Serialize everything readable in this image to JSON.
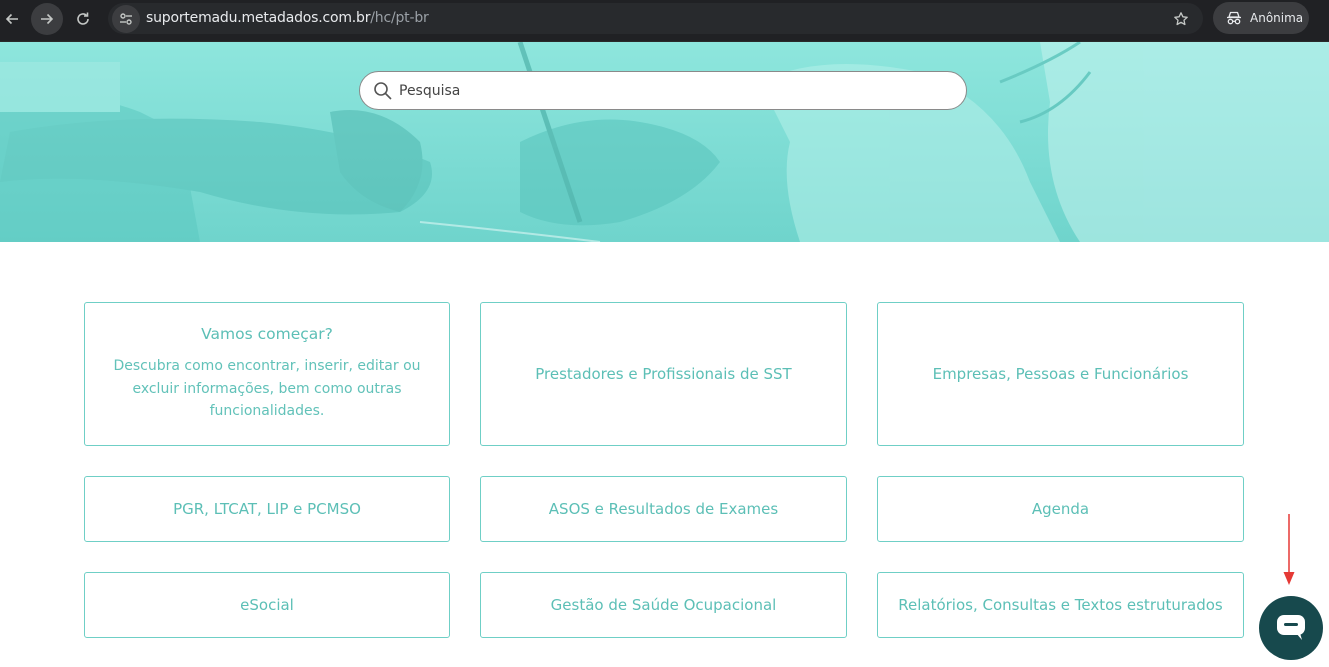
{
  "browser": {
    "url_host": "suportemadu.metadados.com.br",
    "url_path": "/hc/pt-br",
    "incognito_label": "Anônima"
  },
  "search": {
    "placeholder": "Pesquisa"
  },
  "categories": [
    {
      "title": "Vamos começar?",
      "description": "Descubra como encontrar, inserir, editar ou excluir informações, bem como outras funcionalidades."
    },
    {
      "title": "Prestadores e Profissionais de SST"
    },
    {
      "title": "Empresas, Pessoas e Funcionários"
    },
    {
      "title": "PGR, LTCAT, LIP e PCMSO"
    },
    {
      "title": "ASOS e Resultados de Exames"
    },
    {
      "title": "Agenda"
    },
    {
      "title": "eSocial"
    },
    {
      "title": "Gestão de Saúde Ocupacional"
    },
    {
      "title": "Relatórios, Consultas e Textos estruturados"
    }
  ],
  "colors": {
    "accent": "#5cbfb6",
    "hero": "#7ddcd4",
    "chat_button": "#17494d",
    "annotation_arrow": "#e53935"
  }
}
